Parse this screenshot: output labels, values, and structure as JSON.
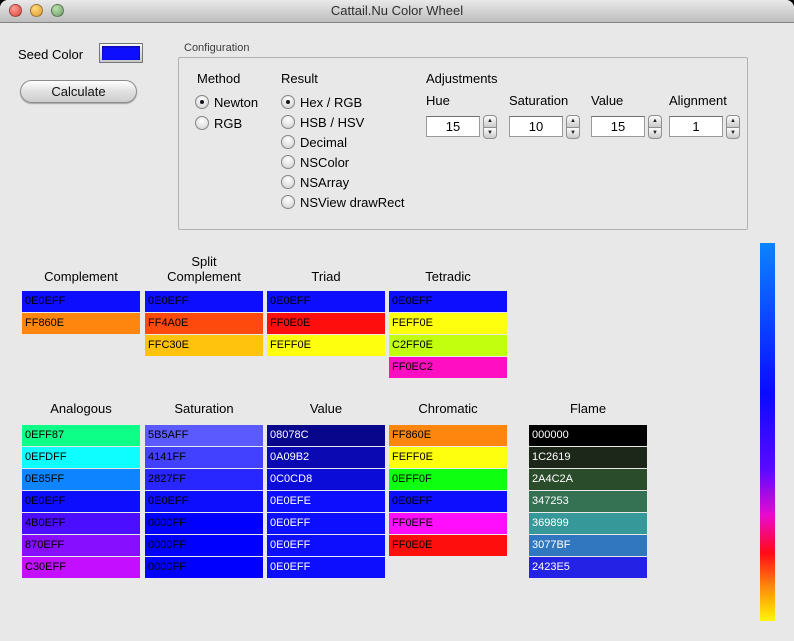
{
  "window": {
    "title": "Cattail.Nu Color Wheel"
  },
  "seed": {
    "label": "Seed Color",
    "color": "#0E0EFF"
  },
  "calculate_label": "Calculate",
  "icons": {
    "stepper_up": "▲",
    "stepper_down": "▼"
  },
  "config": {
    "title": "Configuration",
    "method": {
      "label": "Method",
      "options": [
        {
          "label": "Newton",
          "selected": true
        },
        {
          "label": "RGB",
          "selected": false
        }
      ]
    },
    "result": {
      "label": "Result",
      "options": [
        {
          "label": "Hex / RGB",
          "selected": true
        },
        {
          "label": "HSB / HSV",
          "selected": false
        },
        {
          "label": "Decimal",
          "selected": false
        },
        {
          "label": "NSColor",
          "selected": false
        },
        {
          "label": "NSArray",
          "selected": false
        },
        {
          "label": "NSView drawRect",
          "selected": false
        }
      ]
    },
    "adjustments": {
      "label": "Adjustments",
      "fields": [
        {
          "label": "Hue",
          "value": "15"
        },
        {
          "label": "Saturation",
          "value": "10"
        },
        {
          "label": "Value",
          "value": "15"
        },
        {
          "label": "Alignment",
          "value": "1"
        }
      ]
    }
  },
  "palette_rows": [
    [
      {
        "name": "Complement",
        "text_color": "#000000",
        "swatches": [
          "0E0EFF",
          "FF860E"
        ]
      },
      {
        "name": "Split Complement",
        "text_color": "#000000",
        "swatches": [
          "0E0EFF",
          "FF4A0E",
          "FFC30E"
        ]
      },
      {
        "name": "Triad",
        "text_color": "#000000",
        "swatches": [
          "0E0EFF",
          "FF0E0E",
          "FEFF0E"
        ]
      },
      {
        "name": "Tetradic",
        "text_color": "#000000",
        "swatches": [
          "0E0EFF",
          "FEFF0E",
          "C2FF0E",
          "FF0EC2"
        ]
      }
    ],
    [
      {
        "name": "Analogous",
        "text_color": "#000000",
        "swatches": [
          "0EFF87",
          "0EFDFF",
          "0E85FF",
          "0E0EFF",
          "4B0EFF",
          "870EFF",
          "C30EFF"
        ]
      },
      {
        "name": "Saturation",
        "text_color": "#000000",
        "swatches": [
          "5B5AFF",
          "4141FF",
          "2827FF",
          "0E0EFF",
          "0000FF",
          "0000FF",
          "0000FF"
        ]
      },
      {
        "name": "Value",
        "text_color": "#FFFFFF",
        "swatches": [
          "08078C",
          "0A09B2",
          "0C0CD8",
          "0E0EFE",
          "0E0EFF",
          "0E0EFF",
          "0E0EFF"
        ]
      },
      {
        "name": "Chromatic",
        "text_color": "#000000",
        "swatches": [
          "FF860E",
          "FEFF0E",
          "0EFF0F",
          "0E0EFF",
          "FF0EFE",
          "FF0E0E"
        ]
      },
      {
        "name": "Flame",
        "text_color": "#FFFFFF",
        "swatches": [
          "000000",
          "1C2619",
          "2A4C2A",
          "347253",
          "369899",
          "3077BF",
          "2423E5"
        ]
      }
    ]
  ],
  "gradient_bar": {
    "stops": [
      {
        "color": "#0A84FF",
        "pos": 0
      },
      {
        "color": "#0A0AFF",
        "pos": 40
      },
      {
        "color": "#5A0AFF",
        "pos": 60
      },
      {
        "color": "#E80AD0",
        "pos": 72
      },
      {
        "color": "#FF0A16",
        "pos": 82
      },
      {
        "color": "#FF8A0A",
        "pos": 91
      },
      {
        "color": "#FFF60A",
        "pos": 100
      }
    ]
  }
}
